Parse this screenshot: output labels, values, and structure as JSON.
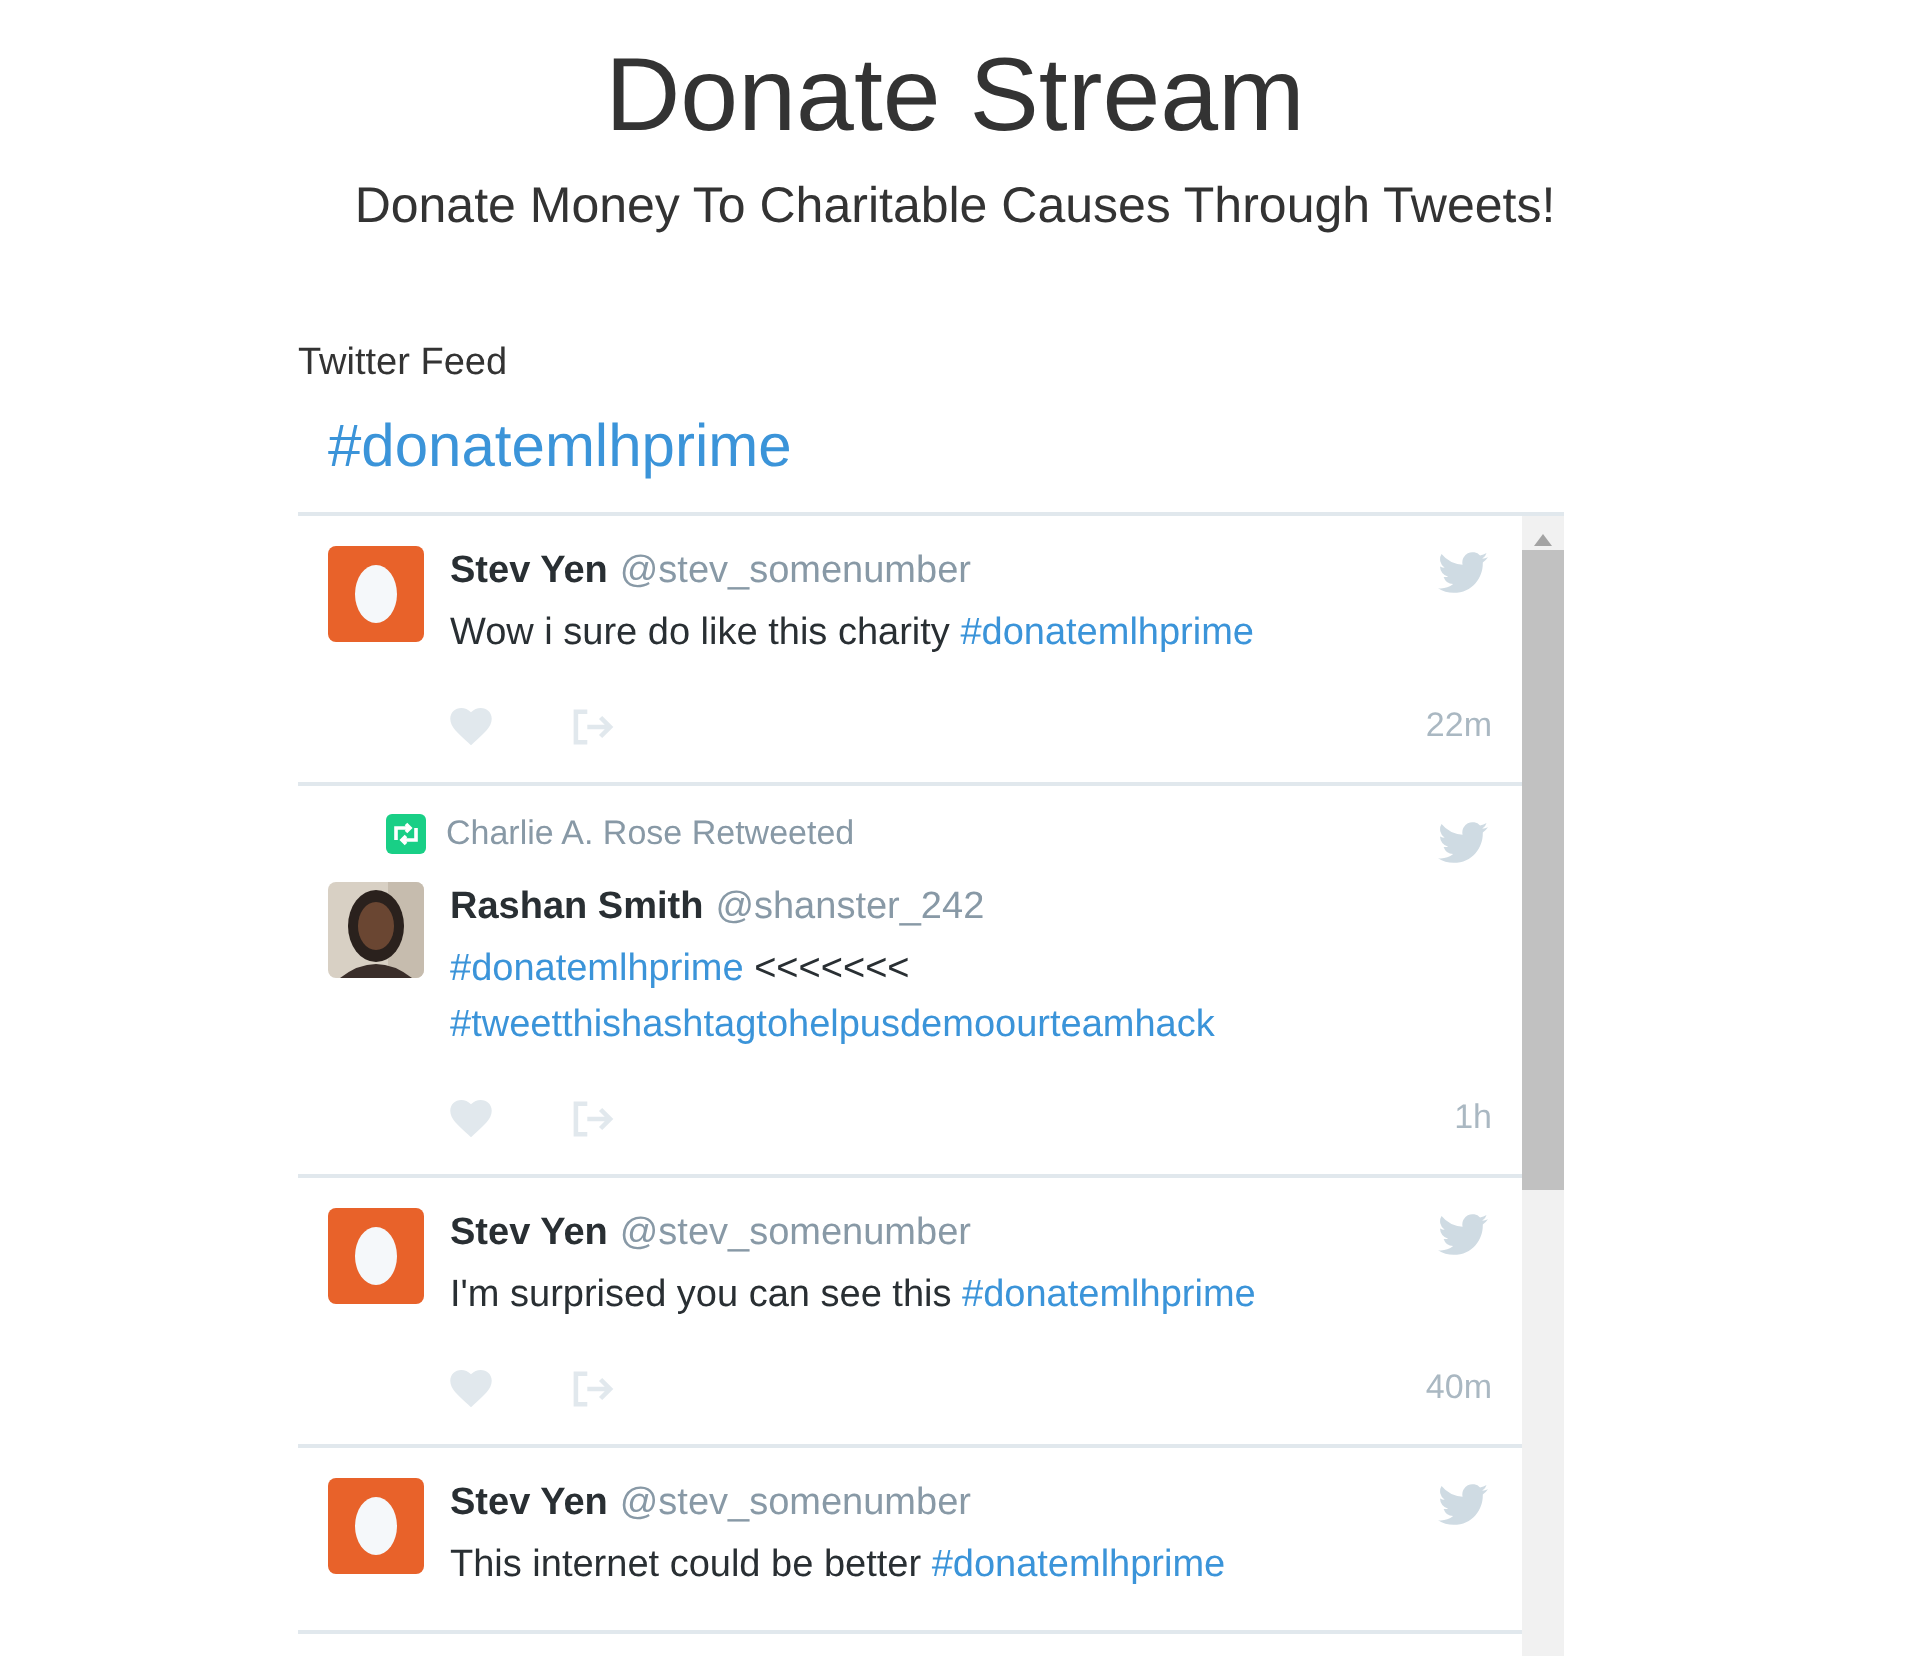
{
  "header": {
    "title": "Donate Stream",
    "subtitle": "Donate Money To Charitable Causes Through Tweets!"
  },
  "feed": {
    "label": "Twitter Feed",
    "hashtag": "#donatemlhprime",
    "tweets": [
      {
        "avatar": {
          "kind": "egg"
        },
        "name": "Stev Yen",
        "handle": "@stev_somenumber",
        "segments": [
          {
            "kind": "text",
            "text": "Wow i sure do like this charity "
          },
          {
            "kind": "hashtag",
            "text": "#donatemlhprime"
          }
        ],
        "time": "22m"
      },
      {
        "retweet": "Charlie A. Rose Retweeted",
        "avatar": {
          "kind": "picture"
        },
        "name": "Rashan Smith",
        "handle": "@shanster_242",
        "segments": [
          {
            "kind": "hashtag",
            "text": "#donatemlhprime"
          },
          {
            "kind": "text",
            "text": " <<<<<<< "
          },
          {
            "kind": "hashtag",
            "text": "#tweetthishashtagtohelpusdemoourteamhack"
          }
        ],
        "time": "1h"
      },
      {
        "avatar": {
          "kind": "egg"
        },
        "name": "Stev Yen",
        "handle": "@stev_somenumber",
        "segments": [
          {
            "kind": "text",
            "text": "I'm surprised you can see this "
          },
          {
            "kind": "hashtag",
            "text": "#donatemlhprime"
          }
        ],
        "time": "40m"
      },
      {
        "avatar": {
          "kind": "egg"
        },
        "name": "Stev Yen",
        "handle": "@stev_somenumber",
        "segments": [
          {
            "kind": "text",
            "text": "This internet could be better "
          },
          {
            "kind": "hashtag",
            "text": "#donatemlhprime"
          }
        ]
      }
    ]
  }
}
